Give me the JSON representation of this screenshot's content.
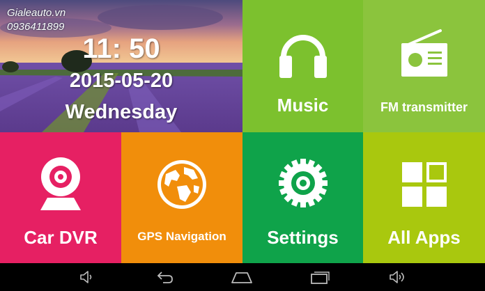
{
  "watermark": {
    "site": "Gialeauto.vn",
    "phone": "0936411899"
  },
  "clock": {
    "time": "11: 50",
    "date": "2015-05-20",
    "weekday": "Wednesday"
  },
  "tiles": {
    "music": {
      "label": "Music",
      "color": "#7cc12e"
    },
    "fm": {
      "label": "FM transmitter",
      "color": "#8bc43d"
    },
    "dvr": {
      "label": "Car DVR",
      "color": "#e62063"
    },
    "gps": {
      "label": "GPS Navigation",
      "color": "#f18e0b"
    },
    "settings": {
      "label": "Settings",
      "color": "#0fa34a"
    },
    "apps": {
      "label": "All Apps",
      "color": "#a9c80e"
    }
  },
  "navbar": {
    "buttons": [
      "volume-down-icon",
      "back-icon",
      "home-icon",
      "recent-apps-icon",
      "volume-up-icon"
    ]
  }
}
